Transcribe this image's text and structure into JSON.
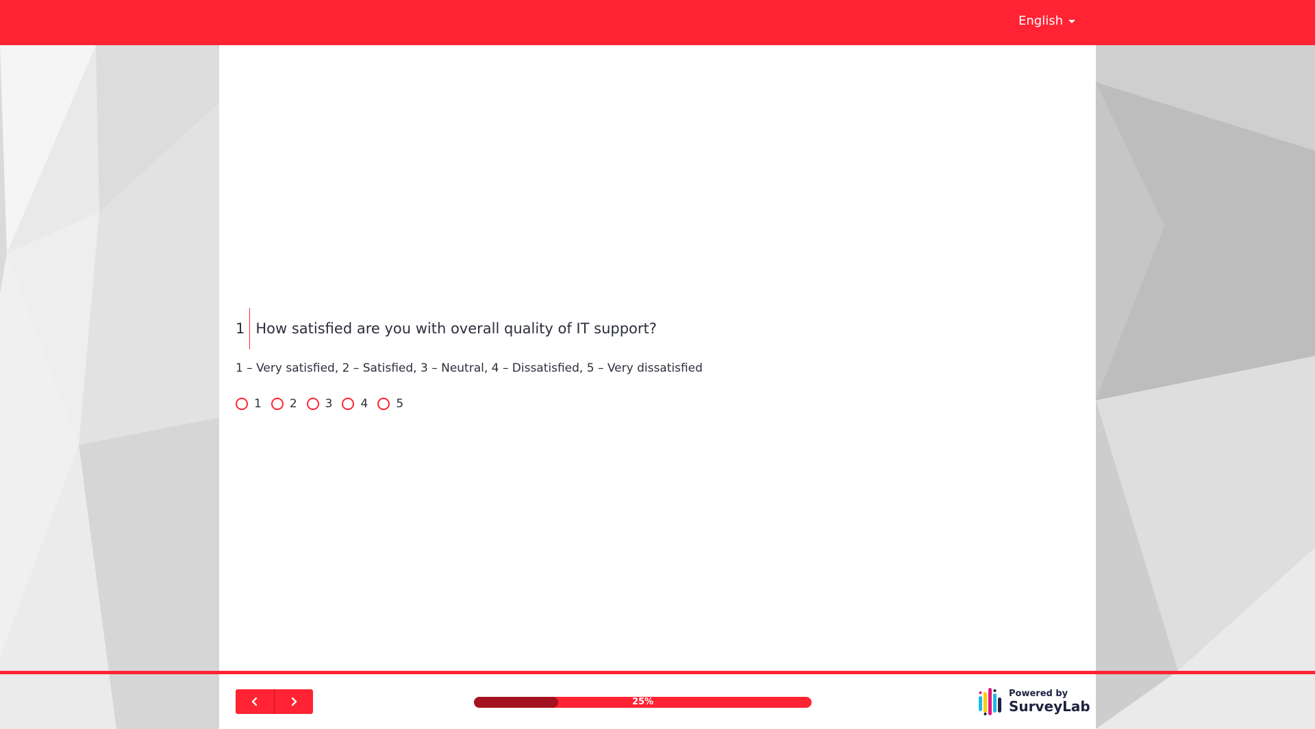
{
  "header": {
    "language": "English"
  },
  "question": {
    "number": "1",
    "text": "How satisfied are you with overall quality of IT support?",
    "hint": "1 – Very satisfied, 2 – Satisfied, 3 – Neutral, 4 – Dissatisfied, 5 – Very dissatisfied",
    "options": [
      "1",
      "2",
      "3",
      "4",
      "5"
    ]
  },
  "footer": {
    "prev_icon": "chevron-left-icon",
    "next_icon": "chevron-right-icon",
    "progress_label": "25%",
    "progress_fraction": 0.25,
    "powered_by": "Powered by",
    "brand": "SurveyLab"
  },
  "colors": {
    "accent": "#ff2333",
    "progress_fill": "#a5121f",
    "text": "#2b2f3a"
  }
}
